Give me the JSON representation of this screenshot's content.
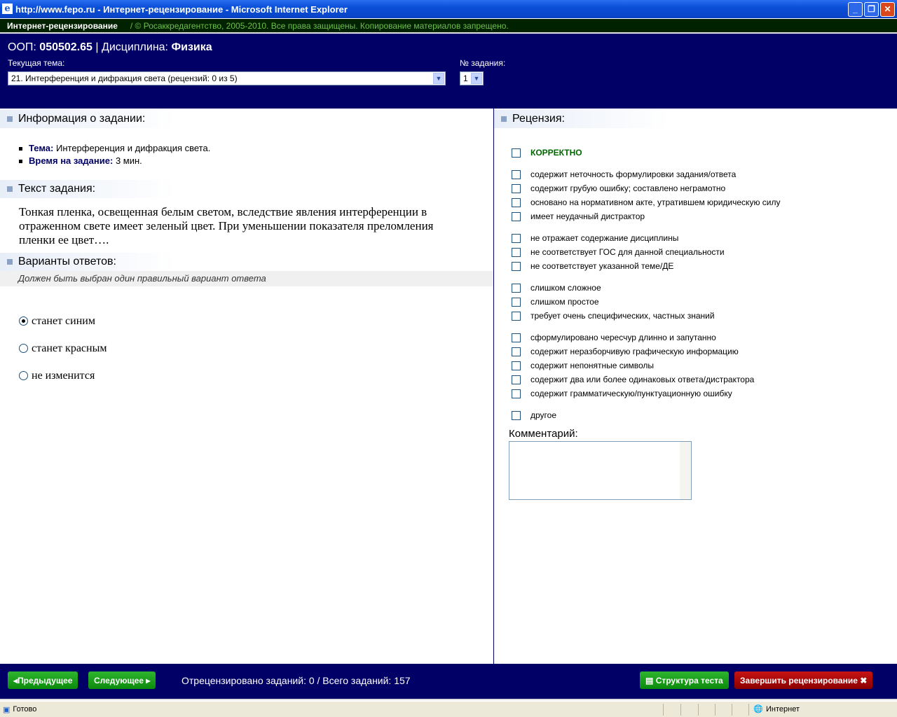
{
  "window": {
    "title": "http://www.fepo.ru - Интернет-рецензирование - Microsoft Internet Explorer"
  },
  "topbar": {
    "app": "Интернет-рецензирование",
    "copyright": "/ © Росаккредагентство, 2005-2010. Все права защищены. Копирование материалов запрещено."
  },
  "header": {
    "oop_label": "ООП:",
    "oop_value": "050502.65",
    "sep": "|",
    "discipline_label": "Дисциплина:",
    "discipline_value": "Физика",
    "topic_label": "Текущая тема:",
    "topic_value": "21. Интерференция и дифракция света  (рецензий: 0 из 5)",
    "task_label": "№ задания:",
    "task_value": "1"
  },
  "info": {
    "title": "Информация о задании:",
    "topic_label": "Тема:",
    "topic_value": "Интерференция и дифракция света.",
    "time_label": "Время на задание:",
    "time_value": "3 мин."
  },
  "task": {
    "title": "Текст задания:",
    "text": "Тонкая пленка, освещенная белым светом, вследствие явления интерференции в отраженном свете имеет зеленый цвет. При уменьшении показателя преломления пленки ее цвет…."
  },
  "answers": {
    "title": "Варианты ответов:",
    "hint": "Должен быть выбран один правильный вариант ответа",
    "options": [
      {
        "label": "станет синим",
        "selected": true
      },
      {
        "label": "станет красным",
        "selected": false
      },
      {
        "label": "не изменится",
        "selected": false
      }
    ]
  },
  "review": {
    "title": "Рецензия:",
    "correct": "КОРРЕКТНО",
    "groups": [
      [
        "содержит неточность формулировки задания/ответа",
        "содержит грубую ошибку; составлено неграмотно",
        "основано на нормативном акте, утратившем юридическую силу",
        "имеет неудачный дистрактор"
      ],
      [
        "не отражает содержание дисциплины",
        "не соответствует ГОС для данной специальности",
        "не соответствует указанной теме/ДЕ"
      ],
      [
        "слишком сложное",
        "слишком простое",
        "требует очень специфических, частных знаний"
      ],
      [
        "сформулировано чересчур длинно и запутанно",
        "содержит неразборчивую графическую информацию",
        "содержит непонятные символы",
        "содержит два или более одинаковых ответа/дистрактора",
        "содержит грамматическую/пунктуационную ошибку"
      ],
      [
        "другое"
      ]
    ],
    "comment_label": "Комментарий:",
    "comment_value": ""
  },
  "footer": {
    "prev": "Предыдущее",
    "next": "Следующее",
    "progress": "Отрецензировано заданий: 0 / Всего заданий: 157",
    "structure": "Структура теста",
    "finish": "Завершить рецензирование"
  },
  "status": {
    "text": "Готово",
    "zone": "Интернет"
  }
}
